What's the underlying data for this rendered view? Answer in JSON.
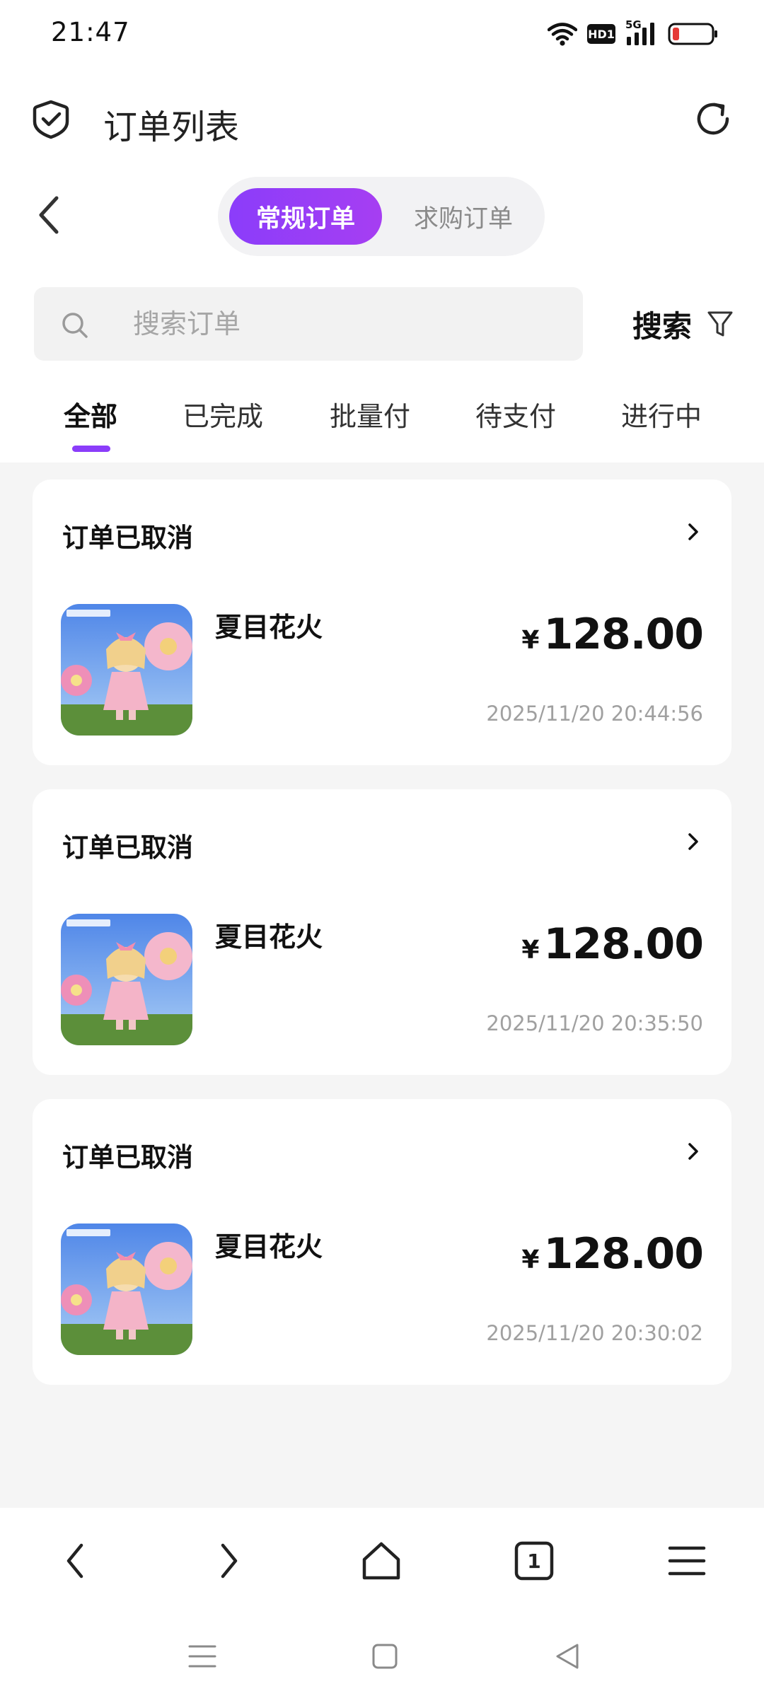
{
  "status_bar": {
    "time": "21:47",
    "icons": [
      "wifi-icon",
      "hd-icon",
      "signal-5g-icon",
      "battery-low-icon"
    ],
    "hd_label": "HD1",
    "network_label": "5G"
  },
  "header": {
    "title": "订单列表",
    "left_icon": "shield-check-icon",
    "right_icon": "refresh-icon"
  },
  "segment": {
    "options": [
      "常规订单",
      "求购订单"
    ],
    "selected": "常规订单"
  },
  "search": {
    "placeholder": "搜索订单",
    "value": "",
    "button_label": "搜索"
  },
  "tabs": [
    {
      "label": "全部",
      "active": true
    },
    {
      "label": "已完成",
      "active": false
    },
    {
      "label": "批量付",
      "active": false
    },
    {
      "label": "待支付",
      "active": false
    },
    {
      "label": "进行中",
      "active": false
    }
  ],
  "orders": [
    {
      "status": "订单已取消",
      "product": "夏目花火",
      "currency": "¥",
      "price": "128.00",
      "time": "2025/11/20 20:44:56"
    },
    {
      "status": "订单已取消",
      "product": "夏目花火",
      "currency": "¥",
      "price": "128.00",
      "time": "2025/11/20 20:35:50"
    },
    {
      "status": "订单已取消",
      "product": "夏目花火",
      "currency": "¥",
      "price": "128.00",
      "time": "2025/11/20 20:30:02"
    }
  ],
  "browser_nav": {
    "tab_count": "1",
    "icons": [
      "back-arrow-icon",
      "forward-arrow-icon",
      "home-icon",
      "tabs-icon",
      "menu-icon"
    ]
  },
  "system_nav": {
    "icons": [
      "recents-icon",
      "home-square-icon",
      "back-triangle-icon"
    ]
  },
  "colors": {
    "accent": "#8B3DFA",
    "accent_end": "#A63EF2",
    "background_list": "#F5F5F5",
    "muted_text": "#A0A0A0",
    "battery_low": "#E53935"
  }
}
